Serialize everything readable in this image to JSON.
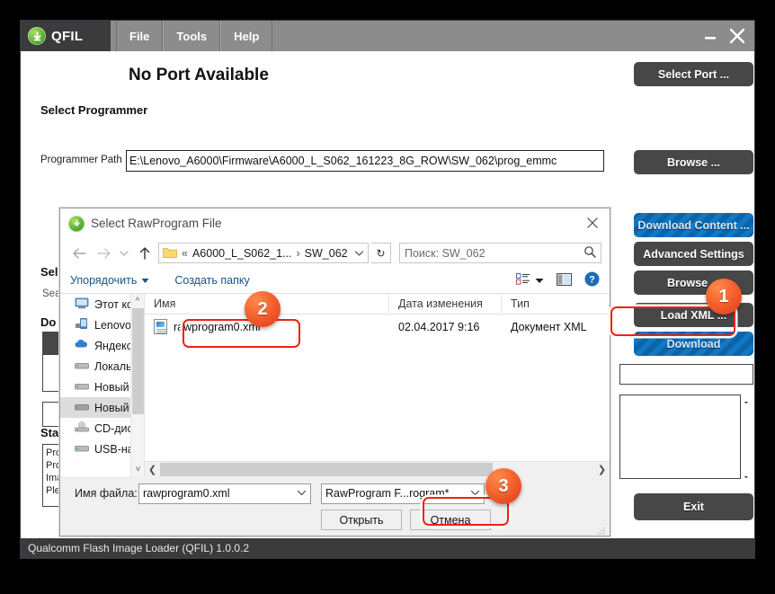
{
  "window": {
    "app_name": "QFIL",
    "menu": [
      "File",
      "Tools",
      "Help"
    ],
    "minimize_label": "Minimize",
    "close_label": "Close",
    "statusbar": "Qualcomm Flash Image Loader (QFIL)  1.0.0.2"
  },
  "main": {
    "port_status": "No Port Available",
    "select_port_button": "Select Port ...",
    "select_programmer_label": "Select Programmer",
    "programmer_path_label": "Programmer Path",
    "programmer_path_value": "E:\\Lenovo_A6000\\Firmware\\A6000_L_S062_161223_8G_ROW\\SW_062\\prog_emmc",
    "browse_button_1": "Browse ...",
    "download_content_button": "Download Content ...",
    "advanced_settings_button": "Advanced Settings",
    "browse_button_2": "Browse ...",
    "load_xml_button": "Load XML ...",
    "download_button": "Download",
    "exit_button": "Exit",
    "select_build_label": "Sel",
    "search_path_label": "Sea",
    "download_section_label": "Do",
    "status_label": "Sta",
    "status_lines": [
      "Prog",
      "Prog",
      "Imag",
      "Plea"
    ],
    "dash_1": "-",
    "dash_2": "-"
  },
  "dialog": {
    "title": "Select RawProgram File",
    "close_label": "Close",
    "nav": {
      "back": "Back",
      "forward": "Forward",
      "recent": "Recent locations",
      "up": "Up one level",
      "crumb_sep": "«",
      "crumb_parent": "A6000_L_S062_1...",
      "crumb_arrow": "›",
      "crumb_current": "SW_062",
      "crumb_dropdown": "∨",
      "refresh": "↻",
      "search_placeholder": "Поиск: SW_062",
      "search_value": "",
      "search_icon": "search-icon"
    },
    "toolbar": {
      "organize": "Упорядочить",
      "new_folder": "Создать папку",
      "view_label": "view-options",
      "preview_label": "preview-pane",
      "help_label": "?"
    },
    "sidebar": [
      {
        "label": "Этот комп",
        "icon": "computer-icon",
        "selected": false
      },
      {
        "label": "Lenovo A",
        "icon": "phone-icon",
        "selected": false
      },
      {
        "label": "Яндекс.Д",
        "icon": "cloud-icon",
        "selected": false
      },
      {
        "label": "Локальны",
        "icon": "drive-icon",
        "selected": false
      },
      {
        "label": "Новый то",
        "icon": "drive-icon",
        "selected": false
      },
      {
        "label": "Новый то",
        "icon": "drive-icon",
        "selected": true
      },
      {
        "label": "CD-диско",
        "icon": "cd-drive-icon",
        "selected": false
      },
      {
        "label": "USB-нако",
        "icon": "drive-icon",
        "selected": false
      }
    ],
    "columns": [
      "Имя",
      "Дата изменения",
      "Тип"
    ],
    "files": [
      {
        "name": "rawprogram0.xml",
        "modified": "02.04.2017 9:16",
        "type": "Документ XML",
        "icon": "xml-file-icon"
      }
    ],
    "footer": {
      "filename_label": "Имя файла:",
      "filename_value": "rawprogram0.xml",
      "filetype_value": "RawProgram F...rogram*",
      "open_button": "Открыть",
      "cancel_button": "Отмена"
    }
  },
  "annotations": {
    "badges": [
      {
        "number": "1",
        "target": "load-xml-button"
      },
      {
        "number": "2",
        "target": "file-row-rawprogram0"
      },
      {
        "number": "3",
        "target": "open-button"
      }
    ],
    "highlight_color": "#ee2211",
    "badge_color": "#f4622d"
  }
}
